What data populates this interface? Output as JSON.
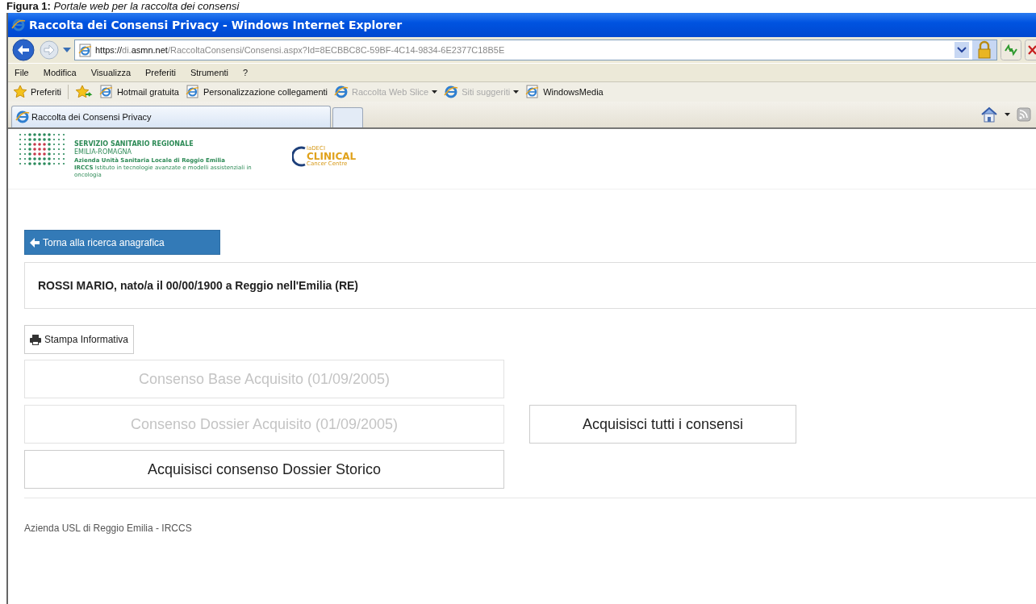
{
  "caption": {
    "label": "Figura 1:",
    "text": "Portale web per la raccolta dei consensi"
  },
  "window": {
    "title": "Raccolta dei Consensi Privacy - Windows Internet Explorer"
  },
  "address": {
    "url": {
      "scheme": "https://",
      "subdomain": "di.",
      "domain": "asmn.net",
      "path": "/RaccoltaConsensi/Consensi.aspx?Id=8ECBBC8C-59BF-4C14-9834-6E2377C18B5E"
    }
  },
  "menu": [
    "File",
    "Modifica",
    "Visualizza",
    "Preferiti",
    "Strumenti",
    "?"
  ],
  "favorites": {
    "label": "Preferiti",
    "items": [
      {
        "label": "Hotmail gratuita",
        "disabled": false,
        "dropdown": false
      },
      {
        "label": "Personalizzazione collegamenti",
        "disabled": false,
        "dropdown": false
      },
      {
        "label": "Raccolta Web Slice",
        "disabled": true,
        "dropdown": true
      },
      {
        "label": "Siti suggeriti",
        "disabled": true,
        "dropdown": true
      },
      {
        "label": "WindowsMedia",
        "disabled": false,
        "dropdown": false
      }
    ]
  },
  "tabs": [
    {
      "label": "Raccolta dei Consensi Privacy",
      "selected": true
    }
  ],
  "header": {
    "org_lines": [
      "SERVIZIO SANITARIO REGIONALE",
      "EMILIA-ROMAGNA",
      "Azienda Unità Sanitaria Locale di Reggio Emilia"
    ],
    "irccs": "IRCCS",
    "irccs_text": "Istituto in tecnologie avanzate e modelli assistenziali in oncologia",
    "partner": {
      "small": "laDECI",
      "name": "CLINICAL",
      "sub": "Cancer Centre"
    }
  },
  "back_button": "Torna alla ricerca anagrafica",
  "patient": "ROSSI MARIO, nato/a il 00/00/1900 a Reggio nell'Emilia (RE)",
  "print_button": "Stampa Informativa",
  "consents": {
    "left": [
      {
        "label": "Consenso Base Acquisito (01/09/2005)",
        "disabled": true
      },
      {
        "label": "Consenso Dossier Acquisito (01/09/2005)",
        "disabled": true
      },
      {
        "label": "Acquisisci consenso Dossier Storico",
        "disabled": false
      }
    ],
    "right": [
      {
        "label": "Acquisisci tutti i consensi",
        "disabled": false
      }
    ]
  },
  "footer": "Azienda USL di Reggio Emilia - IRCCS"
}
